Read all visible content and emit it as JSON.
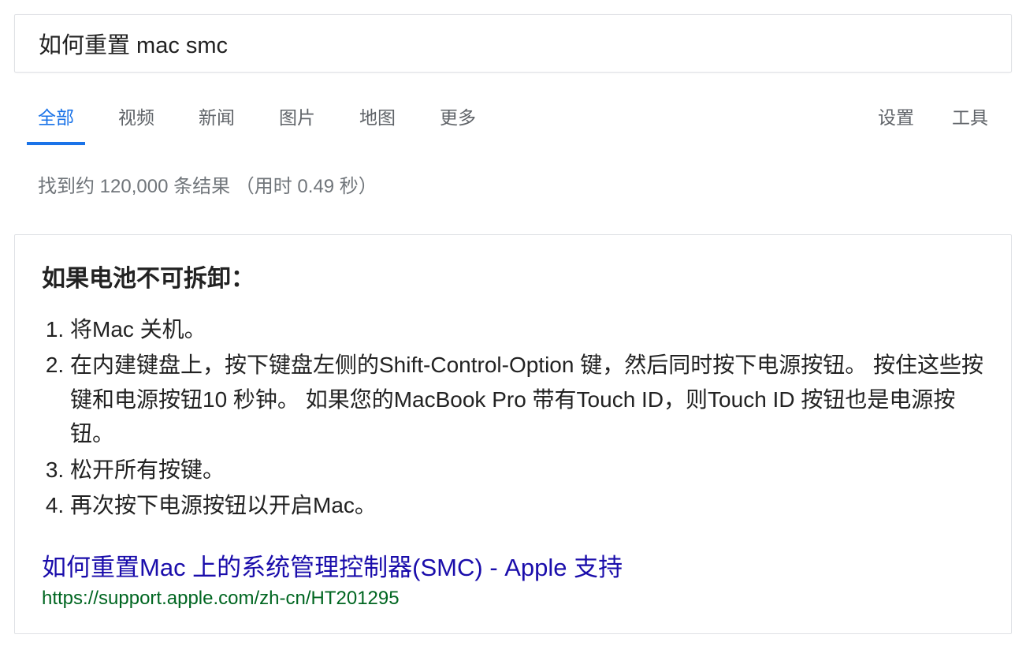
{
  "search": {
    "query": "如何重置 mac smc"
  },
  "tabs": {
    "items": [
      "全部",
      "视频",
      "新闻",
      "图片",
      "地图",
      "更多"
    ],
    "active": "全部",
    "right": [
      "设置",
      "工具"
    ]
  },
  "stats": "找到约 120,000 条结果 （用时 0.49 秒）",
  "snippet": {
    "heading": "如果电池不可拆卸：",
    "steps": [
      "将Mac 关机。",
      "在内建键盘上，按下键盘左侧的Shift-Control-Option 键，然后同时按下电源按钮。 按住这些按键和电源按钮10 秒钟。 如果您的MacBook Pro 带有Touch ID，则Touch ID 按钮也是电源按钮。",
      "松开所有按键。",
      "再次按下电源按钮以开启Mac。"
    ],
    "title": "如何重置Mac 上的系统管理控制器(SMC) - Apple 支持",
    "url": "https://support.apple.com/zh-cn/HT201295"
  }
}
